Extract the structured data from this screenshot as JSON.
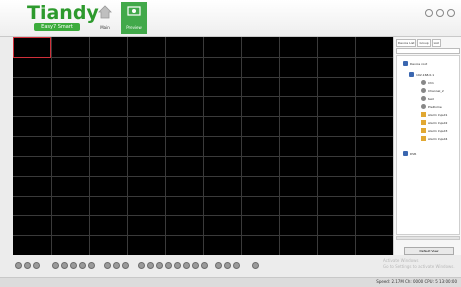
{
  "app": {
    "logo_text": "Tiandy",
    "logo_sub": "Easy7 Smart"
  },
  "nav": {
    "home_label": "Main",
    "preview_label": "Preview"
  },
  "grid": {
    "rows": 11,
    "cols": 10
  },
  "panel": {
    "tabs": [
      "Device List",
      "Group",
      "List"
    ],
    "tree": [
      {
        "label": "Device root",
        "level": 0,
        "icon": "computer"
      },
      {
        "label": "192.168.0.1",
        "level": 1,
        "icon": "computer"
      },
      {
        "label": "Ch1",
        "level": 2,
        "icon": "camera"
      },
      {
        "label": "Channel_2",
        "level": 2,
        "icon": "camera"
      },
      {
        "label": "test",
        "level": 2,
        "icon": "camera"
      },
      {
        "label": "PreDome",
        "level": 2,
        "icon": "camera"
      },
      {
        "label": "Alarm Input1",
        "level": 2,
        "icon": "alarm"
      },
      {
        "label": "Alarm Input2",
        "level": 2,
        "icon": "alarm"
      },
      {
        "label": "Alarm Input3",
        "level": 2,
        "icon": "alarm"
      },
      {
        "label": "Alarm Input4",
        "level": 2,
        "icon": "alarm"
      },
      {
        "label": "DVR",
        "level": 0,
        "icon": "computer"
      }
    ],
    "bottom_button": "Default View"
  },
  "watermark": {
    "line1": "Activate Windows",
    "line2": "Go to Settings to activate Windows."
  },
  "status": {
    "text": "Speed: 2.17M  Ch: 0000  CPU: 5  13:00:00"
  }
}
